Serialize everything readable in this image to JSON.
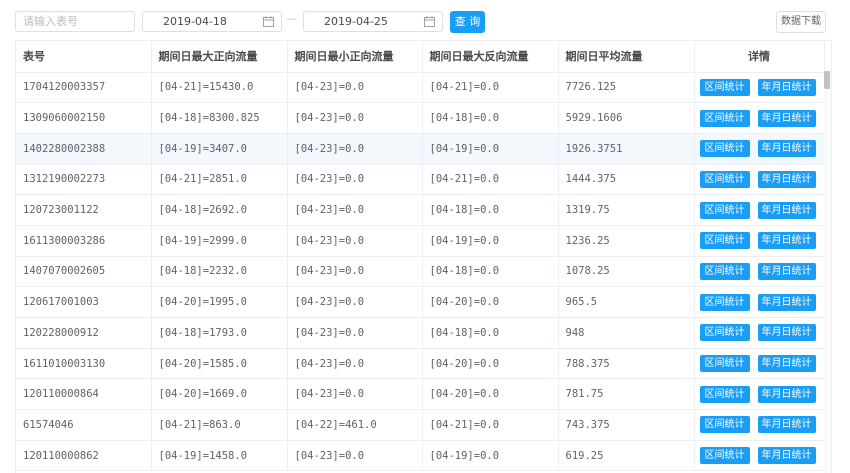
{
  "filters": {
    "meter_placeholder": "请输入表号",
    "start_date": "2019-04-18",
    "date_separator": "—",
    "end_date": "2019-04-25",
    "query_label": "查 询",
    "download_label": "数据下载"
  },
  "table": {
    "headers": [
      "表号",
      "期间日最大正向流量",
      "期间日最小正向流量",
      "期间日最大反向流量",
      "期间日平均流量",
      "详情"
    ],
    "action_labels": {
      "range": "区间统计",
      "ymd": "年月日统计"
    },
    "rows": [
      [
        "1704120003357",
        "[04-21]=15430.0",
        "[04-23]=0.0",
        "[04-21]=0.0",
        "7726.125"
      ],
      [
        "1309060002150",
        "[04-18]=8300.825",
        "[04-23]=0.0",
        "[04-18]=0.0",
        "5929.1606"
      ],
      [
        "1402280002388",
        "[04-19]=3407.0",
        "[04-23]=0.0",
        "[04-19]=0.0",
        "1926.3751"
      ],
      [
        "1312190002273",
        "[04-21]=2851.0",
        "[04-23]=0.0",
        "[04-21]=0.0",
        "1444.375"
      ],
      [
        "120723001122",
        "[04-18]=2692.0",
        "[04-23]=0.0",
        "[04-18]=0.0",
        "1319.75"
      ],
      [
        "1611300003286",
        "[04-19]=2999.0",
        "[04-23]=0.0",
        "[04-19]=0.0",
        "1236.25"
      ],
      [
        "1407070002605",
        "[04-18]=2232.0",
        "[04-23]=0.0",
        "[04-18]=0.0",
        "1078.25"
      ],
      [
        "120617001003",
        "[04-20]=1995.0",
        "[04-23]=0.0",
        "[04-20]=0.0",
        "965.5"
      ],
      [
        "120228000912",
        "[04-18]=1793.0",
        "[04-23]=0.0",
        "[04-18]=0.0",
        "948"
      ],
      [
        "1611010003130",
        "[04-20]=1585.0",
        "[04-23]=0.0",
        "[04-20]=0.0",
        "788.375"
      ],
      [
        "120110000864",
        "[04-20]=1669.0",
        "[04-23]=0.0",
        "[04-20]=0.0",
        "781.75"
      ],
      [
        "61574046",
        "[04-21]=863.0",
        "[04-22]=461.0",
        "[04-21]=0.0",
        "743.375"
      ],
      [
        "120110000862",
        "[04-19]=1458.0",
        "[04-23]=0.0",
        "[04-19]=0.0",
        "619.25"
      ]
    ],
    "highlighted_row": 2
  },
  "colors": {
    "primary": "#1a9df5",
    "border": "#ebeef5",
    "highlight": "#f3f8fd"
  },
  "icons": {
    "calendar": "calendar-icon"
  }
}
